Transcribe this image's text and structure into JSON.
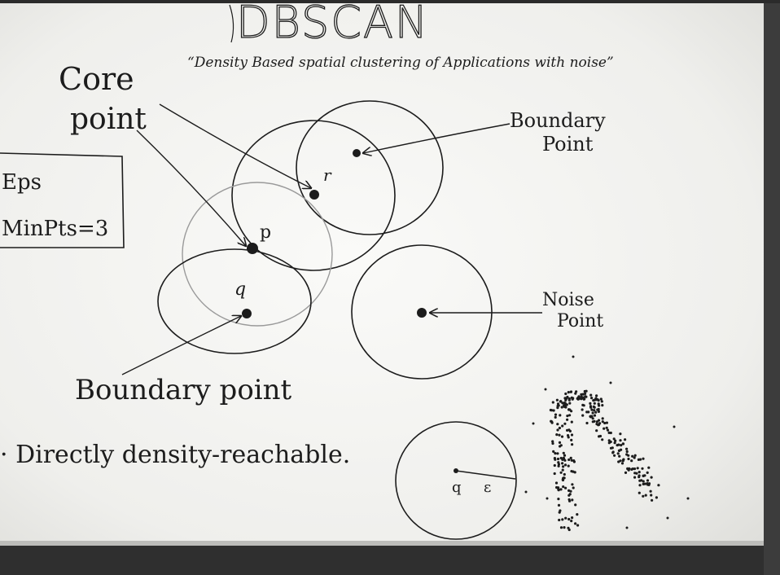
{
  "whiteboard": {
    "title": "DBSCAN",
    "subtitle": "“Density Based spatial clustering of Applications with noise”",
    "params": {
      "eps": "Eps",
      "minpts": "MinPts=3"
    },
    "labels": {
      "core_point": [
        "Core",
        "point"
      ],
      "boundary_point_top": [
        "Boundary",
        "Point"
      ],
      "noise_point": [
        "Noise",
        "Point"
      ],
      "boundary_point_bottom": "Boundary point",
      "point_r": "r",
      "point_p": "p",
      "point_q": "q",
      "point_q_small": "q",
      "epsilon": "ε"
    },
    "note": "· Directly density-reachable.",
    "colors": {
      "board": "#f3f3f1",
      "ink": "#1c1c1c",
      "faint_ink": "#9a9a9a",
      "tray": "#2f2f2f"
    }
  }
}
